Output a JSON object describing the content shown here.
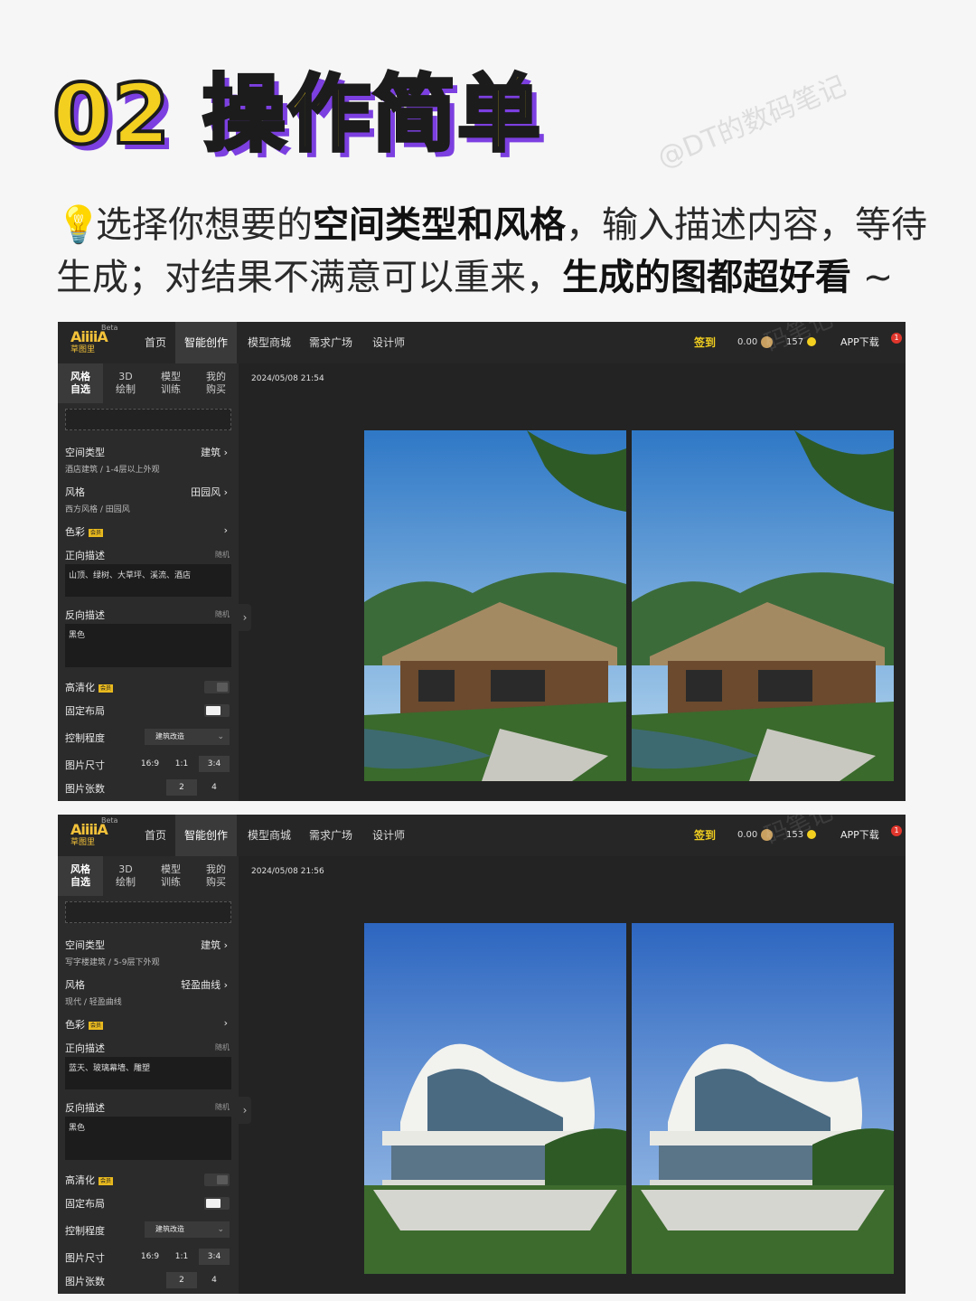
{
  "headline": "02 操作简单",
  "watermark": "@DT的数码笔记",
  "watermark_short": "码笔记",
  "intro": {
    "icon": "lightbulb-icon",
    "emoji": "💡",
    "part1": "选择你想要的",
    "bold1": "空间类型和风格",
    "part2": "，输入描述内容，等待生成；对结果不满意可以重来，",
    "bold2": "生成的图都超好看",
    "tail": " ~"
  },
  "screenshots": [
    {
      "logo": {
        "line1": "AiiiiA",
        "line2": "草图里",
        "beta": "Beta"
      },
      "nav": {
        "items": [
          "首页",
          "智能创作",
          "模型商城",
          "需求广场",
          "设计师"
        ],
        "active": "智能创作"
      },
      "signin": "签到",
      "coins": "0.00",
      "tokens": "157",
      "app_download": "APP下载",
      "notifications": "1",
      "tabs": [
        {
          "l1": "风格",
          "l2": "自选"
        },
        {
          "l1": "3D",
          "l2": "绘制"
        },
        {
          "l1": "模型",
          "l2": "训练"
        },
        {
          "l1": "我的",
          "l2": "购买"
        }
      ],
      "space_type": {
        "label": "空间类型",
        "value": "建筑 ›",
        "sub": "酒店建筑 / 1-4层以上外观"
      },
      "style": {
        "label": "风格",
        "value": "田园风 ›",
        "sub": "西方风格 / 田园风"
      },
      "color": {
        "label": "色彩",
        "badge": "会员",
        "value": "›"
      },
      "positive": {
        "label": "正向描述",
        "random": "随机",
        "text": "山顶、绿树、大草坪、溪流、酒店"
      },
      "negative": {
        "label": "反向描述",
        "random": "随机",
        "text": "黑色"
      },
      "hd": {
        "label": "高清化",
        "badge": "会员",
        "on": false
      },
      "fixed_layout": {
        "label": "固定布局",
        "on": true
      },
      "control": {
        "label": "控制程度",
        "value": "建筑改造"
      },
      "size": {
        "label": "图片尺寸",
        "options": [
          "16:9",
          "1:1",
          "3:4"
        ],
        "selected": "3:4"
      },
      "count": {
        "label": "图片张数",
        "options": [
          "2",
          "4"
        ],
        "selected": "2"
      },
      "timestamp": "2024/05/08 21:54"
    },
    {
      "logo": {
        "line1": "AiiiiA",
        "line2": "草图里",
        "beta": "Beta"
      },
      "nav": {
        "items": [
          "首页",
          "智能创作",
          "模型商城",
          "需求广场",
          "设计师"
        ],
        "active": "智能创作"
      },
      "signin": "签到",
      "coins": "0.00",
      "tokens": "153",
      "app_download": "APP下载",
      "notifications": "1",
      "tabs": [
        {
          "l1": "风格",
          "l2": "自选"
        },
        {
          "l1": "3D",
          "l2": "绘制"
        },
        {
          "l1": "模型",
          "l2": "训练"
        },
        {
          "l1": "我的",
          "l2": "购买"
        }
      ],
      "space_type": {
        "label": "空间类型",
        "value": "建筑 ›",
        "sub": "写字楼建筑 / 5-9层下外观"
      },
      "style": {
        "label": "风格",
        "value": "轻盈曲线 ›",
        "sub": "现代 / 轻盈曲线"
      },
      "color": {
        "label": "色彩",
        "badge": "会员",
        "value": "›"
      },
      "positive": {
        "label": "正向描述",
        "random": "随机",
        "text": "蓝天、玻璃幕墙、雕塑"
      },
      "negative": {
        "label": "反向描述",
        "random": "随机",
        "text": "黑色"
      },
      "hd": {
        "label": "高清化",
        "badge": "会员",
        "on": false
      },
      "fixed_layout": {
        "label": "固定布局",
        "on": true
      },
      "control": {
        "label": "控制程度",
        "value": "建筑改造"
      },
      "size": {
        "label": "图片尺寸",
        "options": [
          "16:9",
          "1:1",
          "3:4"
        ],
        "selected": "3:4"
      },
      "count": {
        "label": "图片张数",
        "options": [
          "2",
          "4"
        ],
        "selected": "2"
      },
      "timestamp": "2024/05/08 21:56"
    }
  ]
}
